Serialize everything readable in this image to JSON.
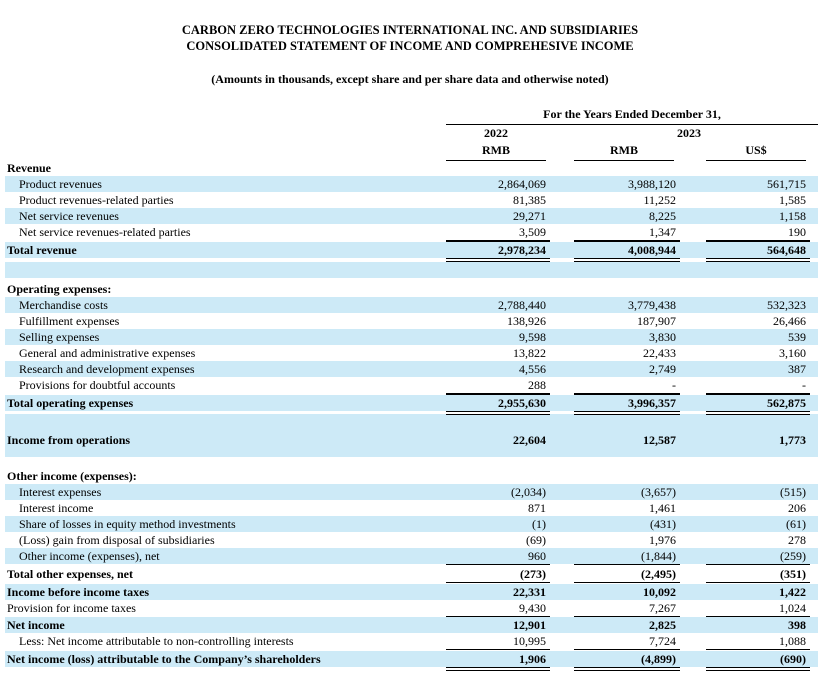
{
  "header": {
    "company": "CARBON ZERO TECHNOLOGIES INTERNATIONAL INC. AND SUBSIDIARIES",
    "statement": "CONSOLIDATED STATEMENT OF INCOME AND COMPREHESIVE INCOME",
    "note": "(Amounts in thousands, except share and per share data and otherwise noted)"
  },
  "columns": {
    "period": "For the Years Ended December 31,",
    "year_2022": "2022",
    "year_2023": "2023",
    "cur_a": "RMB",
    "cur_b": "RMB",
    "cur_c": "US$"
  },
  "rows": [
    {
      "label": "Revenue",
      "v": [
        "",
        "",
        ""
      ],
      "bold": true,
      "indent": false
    },
    {
      "label": "Product revenues",
      "v": [
        "2,864,069",
        "3,988,120",
        "561,715"
      ],
      "indent": true
    },
    {
      "label": "Product revenues-related parties",
      "v": [
        "81,385",
        "11,252",
        "1,585"
      ],
      "indent": true
    },
    {
      "label": "Net service revenues",
      "v": [
        "29,271",
        "8,225",
        "1,158"
      ],
      "indent": true
    },
    {
      "label": "Net service revenues-related parties",
      "v": [
        "3,509",
        "1,347",
        "190"
      ],
      "indent": true
    },
    {
      "label": "Total revenue",
      "v": [
        "2,978,234",
        "4,008,944",
        "564,648"
      ],
      "bold": true
    },
    {
      "label": "",
      "v": [
        "",
        "",
        ""
      ]
    },
    {
      "label": "Operating expenses:",
      "v": [
        "",
        "",
        ""
      ],
      "bold": true
    },
    {
      "label": "Merchandise costs",
      "v": [
        "2,788,440",
        "3,779,438",
        "532,323"
      ],
      "indent": true
    },
    {
      "label": "Fulfillment expenses",
      "v": [
        "138,926",
        "187,907",
        "26,466"
      ],
      "indent": true
    },
    {
      "label": "Selling expenses",
      "v": [
        "9,598",
        "3,830",
        "539"
      ],
      "indent": true
    },
    {
      "label": "General and administrative expenses",
      "v": [
        "13,822",
        "22,433",
        "3,160"
      ],
      "indent": true
    },
    {
      "label": "Research and development expenses",
      "v": [
        "4,556",
        "2,749",
        "387"
      ],
      "indent": true
    },
    {
      "label": "Provisions for doubtful accounts",
      "v": [
        "288",
        "-",
        "-"
      ],
      "indent": true
    },
    {
      "label": "Total operating expenses",
      "v": [
        "2,955,630",
        "3,996,357",
        "562,875"
      ],
      "bold": true
    },
    {
      "label": "Income from operations",
      "v": [
        "22,604",
        "12,587",
        "1,773"
      ],
      "bold": true
    },
    {
      "label": "Other income (expenses):",
      "v": [
        "",
        "",
        ""
      ],
      "bold": true
    },
    {
      "label": "Interest expenses",
      "v": [
        "(2,034)",
        "(3,657)",
        "(515)"
      ],
      "indent": true
    },
    {
      "label": "Interest income",
      "v": [
        "871",
        "1,461",
        "206"
      ],
      "indent": true
    },
    {
      "label": "Share of losses in equity method investments",
      "v": [
        "(1)",
        "(431)",
        "(61)"
      ],
      "indent": true
    },
    {
      "label": "(Loss) gain from disposal of subsidiaries",
      "v": [
        "(69)",
        "1,976",
        "278"
      ],
      "indent": true
    },
    {
      "label": "Other income (expenses), net",
      "v": [
        "960",
        "(1,844)",
        "(259)"
      ],
      "indent": true
    },
    {
      "label": "Total other expenses, net",
      "v": [
        "(273)",
        "(2,495)",
        "(351)"
      ],
      "bold": true
    },
    {
      "label": "Income before income taxes",
      "v": [
        "22,331",
        "10,092",
        "1,422"
      ],
      "bold": true
    },
    {
      "label": "Provision for income taxes",
      "v": [
        "9,430",
        "7,267",
        "1,024"
      ]
    },
    {
      "label": "Net income",
      "v": [
        "12,901",
        "2,825",
        "398"
      ],
      "bold": true
    },
    {
      "label": "Less: Net income attributable to non-controlling interests",
      "v": [
        "10,995",
        "7,724",
        "1,088"
      ],
      "indent": true
    },
    {
      "label": "Net income (loss) attributable to the Company’s shareholders",
      "v": [
        "1,906",
        "(4,899)",
        "(690)"
      ],
      "bold": true
    }
  ]
}
